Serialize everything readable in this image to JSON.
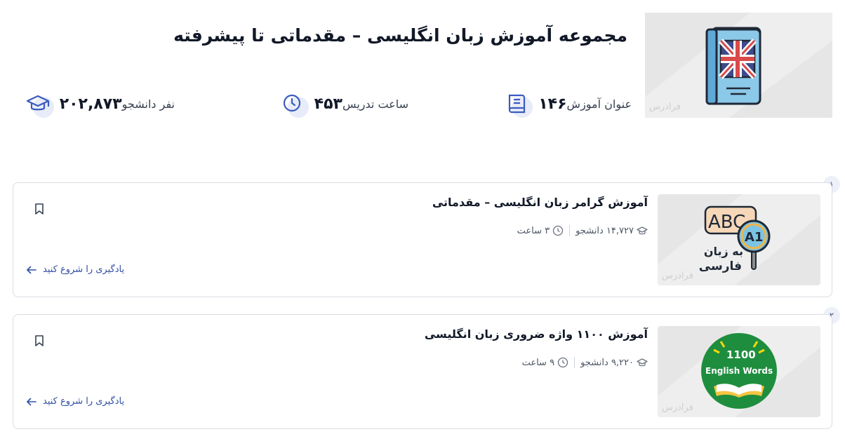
{
  "header": {
    "title": "مجموعه آموزش زبان انگلیسی – مقدماتی تا پیشرفته",
    "thumbnail_icon": "uk-flag-book-icon",
    "watermark": "فرادرس"
  },
  "stats": [
    {
      "value": "۱۴۶",
      "label": "عنوان آموزش",
      "icon": "book-icon"
    },
    {
      "value": "۴۵۳",
      "label": "ساعت تدریس",
      "icon": "clock-icon"
    },
    {
      "value": "۲۰۲,۸۷۳",
      "label": "نفر دانشجو",
      "icon": "graduation-cap-icon"
    }
  ],
  "courses": [
    {
      "index": "۱",
      "title": "آموزش گرامر زبان انگلیسی – مقدماتی",
      "students": "۱۴,۷۲۷ دانشجو",
      "duration": "۳ ساعت",
      "cta": "یادگیری را شروع کنید",
      "thumb_text_1": "ABC",
      "thumb_text_2": "A1",
      "thumb_text_3": "به زبان",
      "thumb_text_4": "فارسی",
      "watermark": "فرادرس"
    },
    {
      "index": "۲",
      "title": "آموزش ۱۱۰۰ واژه ضروری زبان انگلیسی",
      "students": "۹,۲۲۰ دانشجو",
      "duration": "۹ ساعت",
      "cta": "یادگیری را شروع کنید",
      "thumb_text_1": "1100",
      "thumb_text_2": "English Words",
      "watermark": "فرادرس"
    }
  ],
  "colors": {
    "accent": "#2f4ea3",
    "icon_blue": "#3b5bbf",
    "bubble": "#e8ecf8",
    "badge_green": "#1e8e3e"
  }
}
